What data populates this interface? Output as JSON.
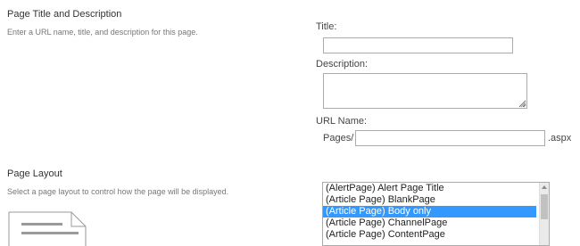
{
  "page_title_section": {
    "heading": "Page Title and Description",
    "description": "Enter a URL name, title, and description for this page."
  },
  "title_field": {
    "label": "Title:",
    "value": ""
  },
  "description_field": {
    "label": "Description:",
    "value": ""
  },
  "url_field": {
    "label": "URL Name:",
    "prefix": "Pages/",
    "value": "",
    "suffix": ".aspx"
  },
  "page_layout_section": {
    "heading": "Page Layout",
    "description": "Select a page layout to control how the page will be displayed."
  },
  "page_layout_list": {
    "items": [
      "(AlertPage) Alert Page Title",
      "(Article Page) BlankPage",
      "(Article Page) Body only",
      "(Article Page) ChannelPage",
      "(Article Page) ContentPage"
    ],
    "selected": "(Article Page) Body only"
  },
  "colors": {
    "selection": "#3399ff",
    "border": "#ababab"
  },
  "icons": {
    "layout_preview": "page-layout-preview-icon",
    "scroll_up": "scroll-up-arrow-icon"
  }
}
